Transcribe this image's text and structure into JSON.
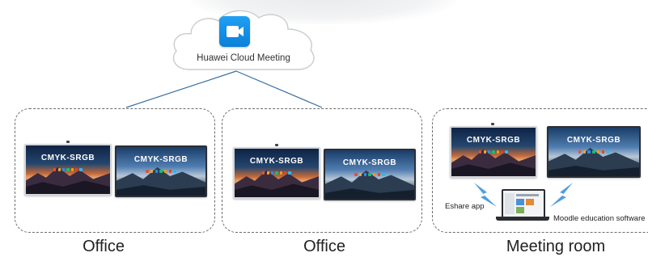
{
  "cloud": {
    "icon": "video-camera-icon",
    "label": "Huawei Cloud Meeting"
  },
  "colors": {
    "accent": "#1a8fe8",
    "link_line": "#3a6f9f"
  },
  "screens": {
    "title": "CMYK-SRGB"
  },
  "groups": [
    {
      "caption": "Office"
    },
    {
      "caption": "Office"
    },
    {
      "caption": "Meeting room"
    }
  ],
  "meeting_room": {
    "eshare_label": "Eshare app",
    "moodle_label": "Moodle education software",
    "laptop_icon": "laptop-icon",
    "wireless_icon": "lightning-bolt-icon"
  }
}
